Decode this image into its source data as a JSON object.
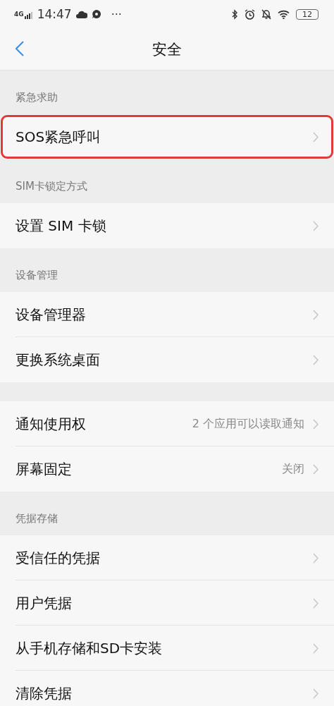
{
  "status_bar": {
    "network": "4G",
    "time": "14:47",
    "more": "···",
    "battery": "12"
  },
  "header": {
    "title": "安全"
  },
  "sections": [
    {
      "label": "紧急求助",
      "items": [
        {
          "label": "SOS紧急呼叫",
          "highlighted": true
        }
      ]
    },
    {
      "label": "SIM卡锁定方式",
      "items": [
        {
          "label": "设置 SIM 卡锁",
          "highlighted": false
        }
      ]
    },
    {
      "label": "设备管理",
      "items": [
        {
          "label": "设备管理器",
          "highlighted": false
        },
        {
          "label": "更换系统桌面",
          "highlighted": false
        }
      ]
    },
    {
      "items": [
        {
          "label": "通知使用权",
          "value": "2 个应用可以读取通知",
          "highlighted": false
        },
        {
          "label": "屏幕固定",
          "value": "关闭",
          "highlighted": false
        }
      ]
    },
    {
      "label": "凭据存储",
      "items": [
        {
          "label": "受信任的凭据",
          "highlighted": false
        },
        {
          "label": "用户凭据",
          "highlighted": false
        },
        {
          "label": "从手机存储和SD卡安装",
          "highlighted": false
        },
        {
          "label": "清除凭据",
          "highlighted": false
        }
      ]
    }
  ]
}
